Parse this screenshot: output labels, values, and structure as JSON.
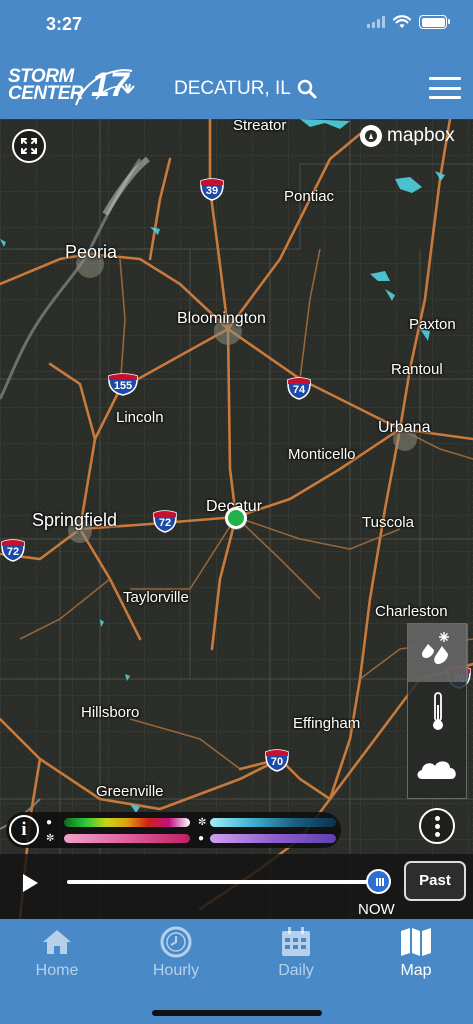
{
  "status": {
    "time": "3:27"
  },
  "header": {
    "logo_line1": "STORM",
    "logo_line2": "CENTER",
    "logo_number": "17",
    "location": "DECATUR, IL"
  },
  "map": {
    "attribution": "mapbox",
    "cities": [
      {
        "name": "Streator"
      },
      {
        "name": "Pontiac"
      },
      {
        "name": "Peoria"
      },
      {
        "name": "Bloomington"
      },
      {
        "name": "Paxton"
      },
      {
        "name": "Rantoul"
      },
      {
        "name": "Lincoln"
      },
      {
        "name": "Urbana"
      },
      {
        "name": "Monticello"
      },
      {
        "name": "Decatur"
      },
      {
        "name": "Springfield"
      },
      {
        "name": "Tuscola"
      },
      {
        "name": "Taylorville"
      },
      {
        "name": "Charleston"
      },
      {
        "name": "Hillsboro"
      },
      {
        "name": "Effingham"
      },
      {
        "name": "Greenville"
      }
    ],
    "interstates": [
      "39",
      "155",
      "74",
      "72",
      "72",
      "70",
      "70",
      "50"
    ],
    "layers": [
      "precipitation",
      "temperature",
      "clouds"
    ],
    "active_layer": "precipitation"
  },
  "timeline": {
    "now_label": "NOW",
    "past_label": "Past",
    "position": 1.0
  },
  "tabs": [
    {
      "label": "Home",
      "icon": "home-icon"
    },
    {
      "label": "Hourly",
      "icon": "clock-icon"
    },
    {
      "label": "Daily",
      "icon": "calendar-icon"
    },
    {
      "label": "Map",
      "icon": "map-icon",
      "active": true
    }
  ],
  "colors": {
    "brand_blue": "#4a89c8",
    "highway": "#c87a3c",
    "radar_cyan": "#4fd0e0",
    "location_dot": "#22b14c"
  }
}
